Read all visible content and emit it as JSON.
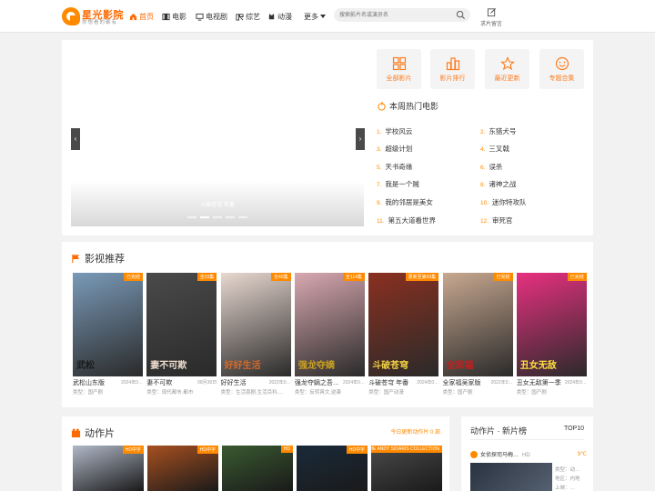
{
  "site": {
    "title": "星光影院",
    "subtitle": "你想看的都有",
    "brand_color": "#ff6a00"
  },
  "nav": {
    "items": [
      {
        "label": "首页",
        "icon": "home-icon",
        "active": true
      },
      {
        "label": "电影",
        "icon": "film-icon"
      },
      {
        "label": "电视剧",
        "icon": "tv-icon"
      },
      {
        "label": "综艺",
        "icon": "variety-icon"
      },
      {
        "label": "动漫",
        "icon": "anime-icon"
      },
      {
        "label": "更多",
        "icon": "chevron-down-icon"
      }
    ]
  },
  "search": {
    "placeholder": "搜索影片名或演员名"
  },
  "message": {
    "label": "求片留言"
  },
  "hero": {
    "slide_caption": "斗破苍穹 年番",
    "quick_links": [
      {
        "label": "全部影片",
        "icon": "grid-icon"
      },
      {
        "label": "影片排行",
        "icon": "rank-icon"
      },
      {
        "label": "最近更新",
        "icon": "star-icon"
      },
      {
        "label": "专题合集",
        "icon": "smile-icon"
      }
    ],
    "hot_title": "本周热门电影",
    "hot_list": [
      {
        "num": "1.",
        "name": "学校风云"
      },
      {
        "num": "2.",
        "name": "东猎犬号"
      },
      {
        "num": "3.",
        "name": "超级计划"
      },
      {
        "num": "4.",
        "name": "三叉戟"
      },
      {
        "num": "5.",
        "name": "天书奇缘"
      },
      {
        "num": "6.",
        "name": "误杀"
      },
      {
        "num": "7.",
        "name": "我是一个贼"
      },
      {
        "num": "8.",
        "name": "诸神之战"
      },
      {
        "num": "9.",
        "name": "我的邻居是美女"
      },
      {
        "num": "10.",
        "name": "迷你特攻队"
      },
      {
        "num": "11.",
        "name": "第五大道看世界"
      },
      {
        "num": "12.",
        "name": "审死官"
      }
    ]
  },
  "recommend": {
    "title": "影视推荐",
    "items": [
      {
        "badge": "已完结",
        "poster": "武松",
        "title": "武松山东版",
        "year": "2024年0…",
        "type": "类型：国产剧",
        "bg": "#7a9ab8",
        "fg": "#1a1a1a"
      },
      {
        "badge": "全33集",
        "poster": "妻不可欺",
        "title": "妻不可欺",
        "year": "08月30日",
        "type": "类型：现代都市,都市",
        "bg": "#4a4a4a",
        "fg": "#f0e0d0"
      },
      {
        "badge": "全40集",
        "poster": "好好生活",
        "title": "好好生活",
        "year": "2022年0…",
        "type": "类型：生活喜剧,生活百科,…",
        "bg": "#e8d8d0",
        "fg": "#d46a2a"
      },
      {
        "badge": "全114集",
        "poster": "强龙夺嫡",
        "title": "强龙夺嫡之吾…",
        "year": "2024年0…",
        "type": "类型：反转爽文,逆袭",
        "bg": "#d8a8b0",
        "fg": "#c8a020"
      },
      {
        "badge": "更新至第69集",
        "poster": "斗破苍穹",
        "title": "斗破苍穹 年番",
        "year": "2024年0…",
        "type": "类型：国产动漫",
        "bg": "#8a3020",
        "fg": "#f0d040"
      },
      {
        "badge": "已完结",
        "poster": "全家福",
        "title": "全家福吴家版",
        "year": "2022年0…",
        "type": "类型：国产剧",
        "bg": "#c8a890",
        "fg": "#c02020"
      },
      {
        "badge": "已完结",
        "poster": "丑女无敌",
        "title": "丑女无敌第一季",
        "year": "2024年0…",
        "type": "类型：国产剧",
        "bg": "#e83080",
        "fg": "#ffe040"
      }
    ]
  },
  "action": {
    "title": "动作片",
    "update_text": "今日更新动作片 0 部",
    "items": [
      {
        "badge": "HD中字",
        "bg": "#b0b8c8"
      },
      {
        "badge": "HD中字",
        "bg": "#a85020"
      },
      {
        "badge": "HD",
        "bg": "#3a5a30"
      },
      {
        "badge": "HD中字",
        "bg": "#1a2a3a"
      },
      {
        "badge": "THE ANDY SIDARIS COLLECTION",
        "bg": "#4a4a4a"
      }
    ]
  },
  "ranking": {
    "title": "动作片 · 新片榜",
    "top_label": "TOP10",
    "first": {
      "name": "女侦探司马梅…",
      "ep": "HD",
      "score": "9℃"
    },
    "meta": [
      "类型：动…",
      "地区：内地",
      "上映：…"
    ]
  },
  "colors": {
    "accent": "#ff8a00",
    "badge": "#ff8a00"
  }
}
